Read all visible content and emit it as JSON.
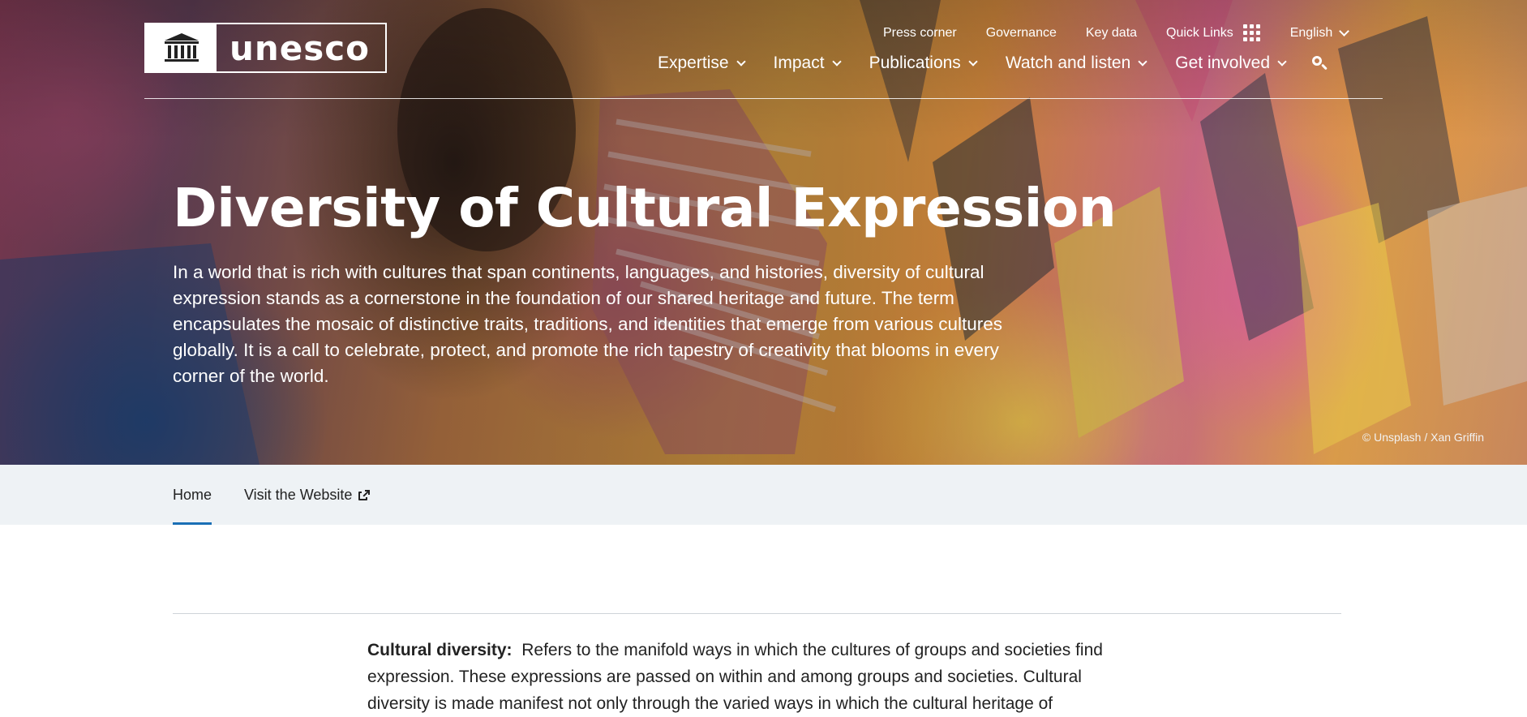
{
  "brand": {
    "logo_text": "unesco"
  },
  "utility_nav": {
    "press_corner": "Press corner",
    "governance": "Governance",
    "key_data": "Key data",
    "quick_links": "Quick Links",
    "language": "English"
  },
  "main_nav": {
    "items": [
      {
        "label": "Expertise"
      },
      {
        "label": "Impact"
      },
      {
        "label": "Publications"
      },
      {
        "label": "Watch and listen"
      },
      {
        "label": "Get involved"
      }
    ]
  },
  "hero": {
    "title": "Diversity of Cultural Expression",
    "description": "In a world that is rich with cultures that span continents, languages, and histories, diversity of cultural expression stands as a cornerstone in the foundation of our shared heritage and future. The term encapsulates the mosaic of distinctive traits, traditions, and identities that emerge from various cultures globally. It is a call to celebrate, protect, and promote the rich tapestry of creativity that blooms in every corner of the world.",
    "credit": "© Unsplash / Xan Griffin"
  },
  "subnav": {
    "tabs": [
      {
        "label": "Home",
        "active": true
      },
      {
        "label": "Visit the Website",
        "active": false
      }
    ]
  },
  "content": {
    "term": "Cultural diversity:",
    "definition": "Refers to the manifold ways in which the cultures of groups and societies find expression. These expressions are passed on within and among groups and societies.  Cultural diversity is made manifest not only through the varied ways in which the cultural heritage of"
  },
  "colors": {
    "accent": "#1a6fb5",
    "subnav_bg": "#eef2f5"
  },
  "icons": [
    "unesco-temple-icon",
    "grid-icon",
    "chevron-down-icon",
    "search-icon",
    "external-link-icon"
  ]
}
